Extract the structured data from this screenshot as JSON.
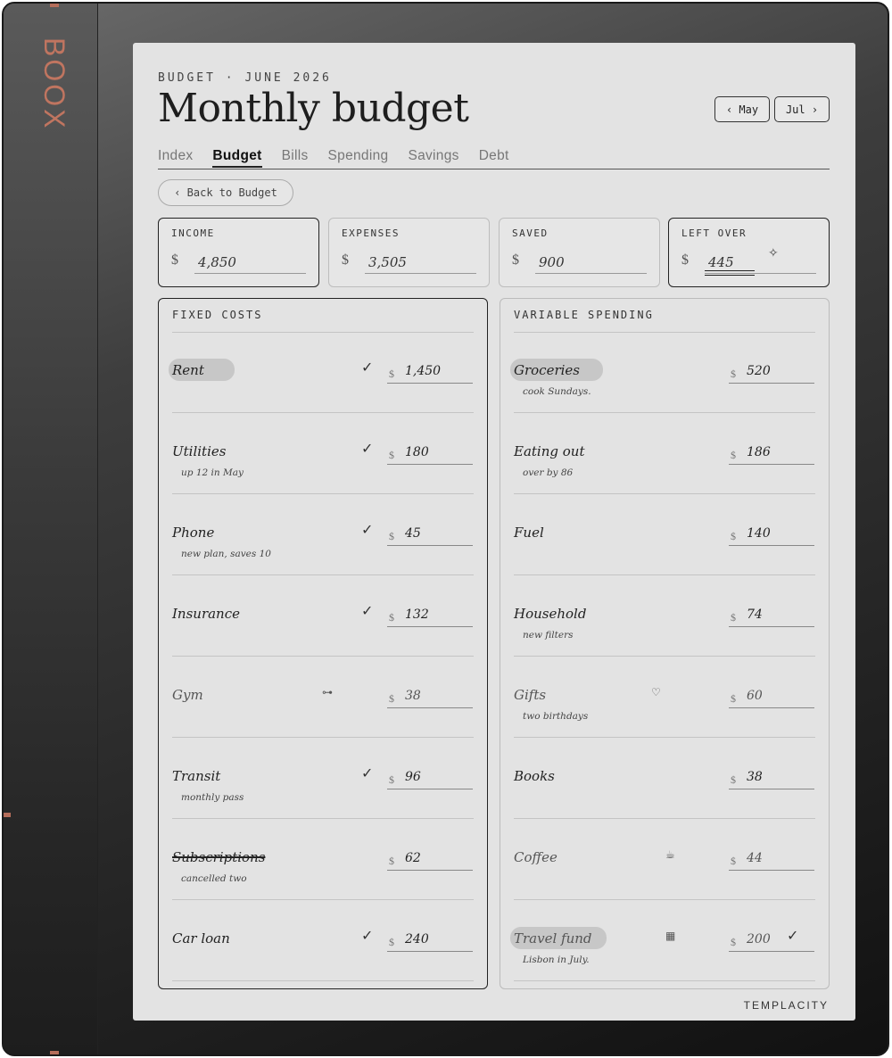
{
  "device": {
    "brand": "BOOX"
  },
  "header": {
    "eyebrow": "BUDGET · JUNE 2026",
    "title": "Monthly budget",
    "prev_label": "‹ May",
    "next_label": "Jul ›"
  },
  "tabs": [
    {
      "label": "Index",
      "active": false
    },
    {
      "label": "Budget",
      "active": true
    },
    {
      "label": "Bills",
      "active": false
    },
    {
      "label": "Spending",
      "active": false
    },
    {
      "label": "Savings",
      "active": false
    },
    {
      "label": "Debt",
      "active": false
    }
  ],
  "back_label": "‹ Back to Budget",
  "currency": "$",
  "summary": [
    {
      "label": "INCOME",
      "value": "4,850"
    },
    {
      "label": "EXPENSES",
      "value": "3,505"
    },
    {
      "label": "SAVED",
      "value": "900"
    },
    {
      "label": "LEFT OVER",
      "value": "445"
    }
  ],
  "fixed": {
    "title": "FIXED COSTS",
    "rows": [
      {
        "name": "Rent",
        "note": "",
        "amount": "1,450",
        "check": "✓"
      },
      {
        "name": "Utilities",
        "note": "up 12 in May",
        "amount": "180",
        "check": "✓"
      },
      {
        "name": "Phone",
        "note": "new plan, saves 10",
        "amount": "45",
        "check": "✓"
      },
      {
        "name": "Insurance",
        "note": "",
        "amount": "132",
        "check": "✓"
      },
      {
        "name": "Gym",
        "note": "",
        "amount": "38",
        "icon": "dumbbell-icon",
        "glyph": "⊶"
      },
      {
        "name": "Transit",
        "note": "monthly pass",
        "amount": "96",
        "check": "✓"
      },
      {
        "name": "Subscriptions",
        "note": "cancelled two",
        "amount": "62"
      },
      {
        "name": "Car loan",
        "note": "",
        "amount": "240",
        "check": "✓"
      }
    ]
  },
  "variable": {
    "title": "VARIABLE SPENDING",
    "rows": [
      {
        "name": "Groceries",
        "note": "cook Sundays.",
        "amount": "520"
      },
      {
        "name": "Eating out",
        "note": "over by 86",
        "amount": "186"
      },
      {
        "name": "Fuel",
        "note": "",
        "amount": "140"
      },
      {
        "name": "Household",
        "note": "new filters",
        "amount": "74"
      },
      {
        "name": "Gifts",
        "note": "two birthdays",
        "amount": "60",
        "icon": "heart-icon",
        "glyph": "♡"
      },
      {
        "name": "Books",
        "note": "",
        "amount": "38"
      },
      {
        "name": "Coffee",
        "note": "",
        "amount": "44",
        "icon": "coffee-cup-icon",
        "glyph": "☕"
      },
      {
        "name": "Travel fund",
        "note": "Lisbon in July.",
        "amount": "200",
        "icon": "building-icon",
        "glyph": "▦",
        "check": "✓"
      }
    ]
  },
  "footer": {
    "logo": "TEMPLACITY"
  }
}
